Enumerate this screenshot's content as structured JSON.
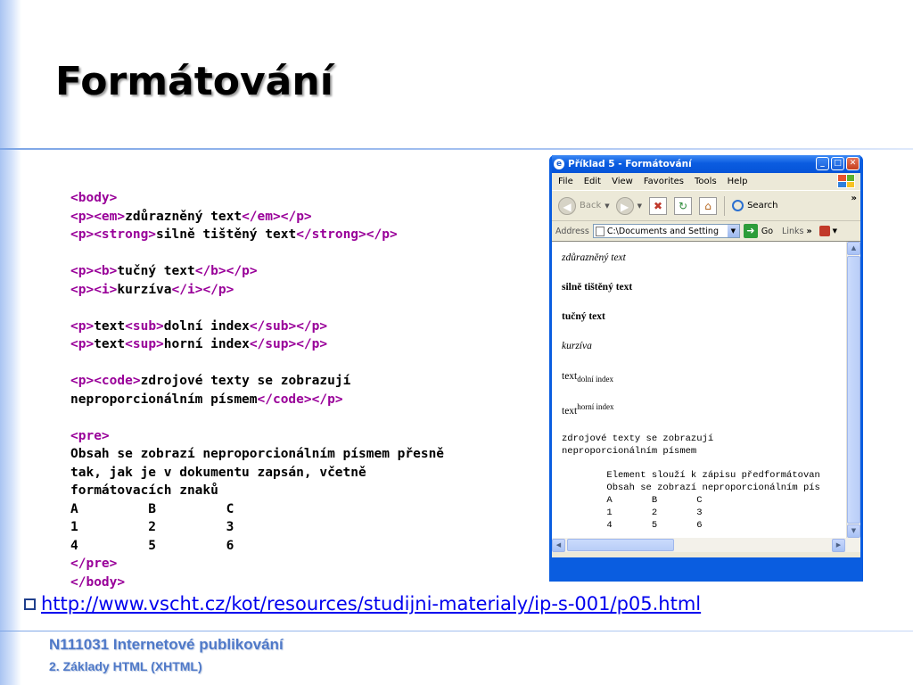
{
  "slide": {
    "title": "Formátování",
    "link_url": "http://www.vscht.cz/kot/resources/studijni-materialy/ip-s-001/p05.html",
    "footer_course": "N111031 Internetové publikování",
    "footer_chapter": "2. Základy HTML (XHTML)"
  },
  "code": {
    "body_open": "<body>",
    "p_open": "<p>",
    "p_close": "</p>",
    "em_open": "<em>",
    "em_close": "</em>",
    "em_text": "zdůrazněný text",
    "strong_open": "<strong>",
    "strong_close": "</strong>",
    "strong_text": "silně tištěný text",
    "b_open": "<b>",
    "b_close": "</b>",
    "b_text": "tučný text",
    "i_open": "<i>",
    "i_close": "</i>",
    "i_text": "kurzíva",
    "plain_text": "text",
    "sub_open": "<sub>",
    "sub_close": "</sub>",
    "sub_text": "dolní index",
    "sup_open": "<sup>",
    "sup_close": "</sup>",
    "sup_text": "horní index",
    "code_open": "<code>",
    "code_close": "</code>",
    "code_text1": "zdrojové texty se zobrazují",
    "code_text2": "neproporcionálním písmem",
    "pre_open": "<pre>",
    "pre_close": "</pre>",
    "pre_lines": [
      "Obsah se zobrazí neproporcionálním písmem přesně",
      "tak, jak je v dokumentu zapsán, včetně",
      "formátovacích znaků",
      "A         B         C",
      "1         2         3",
      "4         5         6"
    ],
    "body_close": "</body>"
  },
  "browser": {
    "window_title": "Příklad 5 - Formátování",
    "menu": [
      "File",
      "Edit",
      "View",
      "Favorites",
      "Tools",
      "Help"
    ],
    "toolbar": {
      "back_label": "Back",
      "search_label": "Search"
    },
    "address_label": "Address",
    "address_value": "C:\\Documents and Setting",
    "go_label": "Go",
    "links_label": "Links",
    "rendered": {
      "em": "zdůrazněný text",
      "strong": "silně tištěný text",
      "b": "tučný text",
      "i": "kurzíva",
      "sub_base": "text",
      "sub": "dolní index",
      "sup_base": "text",
      "sup": "horní index",
      "code1": "zdrojové texty se zobrazují",
      "code2": "neproporcionálním písmem",
      "pre_lines": [
        "        Element slouží k zápisu předformátovan",
        "        Obsah se zobrazí neproporcionálním pís",
        "        A       B       C",
        "        1       2       3",
        "        4       5       6"
      ]
    }
  }
}
